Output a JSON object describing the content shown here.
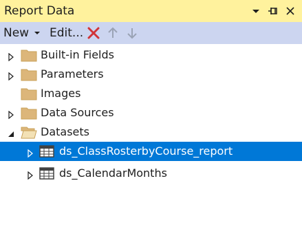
{
  "window": {
    "title": "Report Data"
  },
  "toolbar": {
    "new_label": "New",
    "edit_label": "Edit..."
  },
  "tree": {
    "items": [
      {
        "label": "Built-in Fields",
        "icon": "folder-icon",
        "expander": "collapsed"
      },
      {
        "label": "Parameters",
        "icon": "folder-icon",
        "expander": "collapsed"
      },
      {
        "label": "Images",
        "icon": "folder-icon",
        "expander": "none"
      },
      {
        "label": "Data Sources",
        "icon": "folder-icon",
        "expander": "collapsed"
      },
      {
        "label": "Datasets",
        "icon": "open-folder-icon",
        "expander": "expanded"
      },
      {
        "label": "ds_ClassRosterbyCourse_report",
        "icon": "dataset-table-icon",
        "expander": "collapsed",
        "selected": true
      },
      {
        "label": "ds_CalendarMonths",
        "icon": "dataset-table-icon",
        "expander": "collapsed"
      }
    ]
  },
  "colors": {
    "title_bar_bg": "#fff29d",
    "toolbar_bg": "#ccd5f0",
    "selection_bg": "#0078d7",
    "delete_icon": "#d13438",
    "folder": "#dcb67a"
  }
}
